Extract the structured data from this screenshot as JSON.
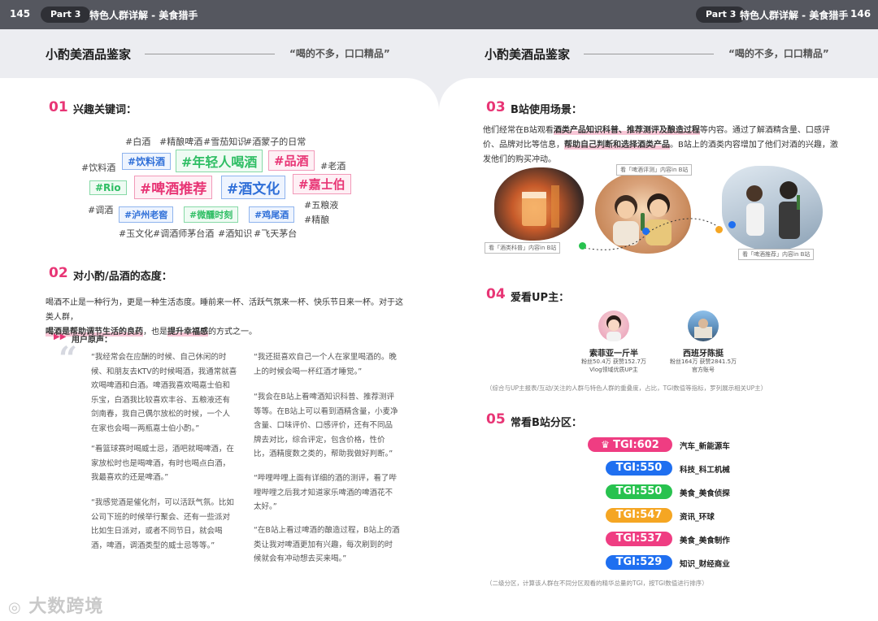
{
  "header": {
    "left_page_num": "145",
    "right_page_num": "146",
    "part_label": "Part 3",
    "section_title": "特色人群详解 - 美食猎手"
  },
  "section": {
    "title": "小酌美酒品鉴家",
    "tagline": "“喝的不多，口口精品”"
  },
  "left": {
    "s01": {
      "num": "01",
      "title": "兴趣关键词：",
      "tags": [
        "#白酒",
        "#精酿啤酒",
        "#雪茄知识",
        "#酒蒙子的日常",
        "#饮料酒",
        "#饮料酒",
        "#年轻人喝酒",
        "#品酒",
        "#老酒",
        "#Rio",
        "#啤酒推荐",
        "#酒文化",
        "#嘉士伯",
        "#五粮液",
        "#调酒",
        "#泸州老窖",
        "#微醺时刻",
        "#鸡尾酒",
        "#精酿",
        "#玉文化",
        "#调酒师茅台酒",
        "#酒知识",
        "#飞天茅台"
      ]
    },
    "s02": {
      "num": "02",
      "title": "对小酌/品酒的态度：",
      "p1": "喝酒不止是一种行为，更是一种生活态度。睡前来一杯、活跃气氛来一杯、快乐节日来一杯。对于这类人群，",
      "p2_hl1": "喝酒是帮助调节生活的良药",
      "p2_mid": "，也是",
      "p2_hl2": "提升幸福感",
      "p2_end": "的方式之一。",
      "voice_label": "用户原声：",
      "col1": [
        "“我经常会在应酬的时候、自己休闲的时候、和朋友去KTV的时候喝酒，我通常就喜欢喝啤酒和白酒。啤酒我喜欢喝嘉士伯和乐宝，白酒我比较喜欢丰谷、五粮液还有剑南春，我自己偶尔放松的时候，一个人在家也会喝一两瓶嘉士伯小酌。”",
        "“看篮球赛时喝威士忌，酒吧就喝啤酒，在家放松时也是喝啤酒，有时也喝点白酒，我最喜欢的还是啤酒。”",
        "“我感觉酒是催化剂，可以活跃气氛。比如公司下班的时候举行聚会、还有一些派对比如生日派对，或者不同节日，就会喝酒，啤酒，调酒类型的威士忌等等。”"
      ],
      "col2": [
        "“我还挺喜欢自己一个人在家里喝酒的。晚上的时候会喝一杯红酒才睡觉。”",
        "“我会在B站上看啤酒知识科普、推荐测评等等。在B站上可以看到酒精含量，小麦净含量、口味评价、口感评价，还有不同品牌去对比，综合评定，包含价格，性价比，酒精度数之类的，帮助我做好判断。”",
        "“哔哩哔哩上面有详细的酒的测评，看了哔哩哔哩之后我才知道家乐啤酒的啤酒花不太好。”",
        "“在B站上看过啤酒的酿造过程，B站上的酒类让我对啤酒更加有兴趣，每次刷到的时候就会有冲动想去买来喝。”"
      ]
    }
  },
  "right": {
    "s03": {
      "num": "03",
      "title": "B站使用场景：",
      "t1": "他们经常在B站观看",
      "hl1": "酒类产品知识科普、推荐测评及酿造过程",
      "t2": "等内容。通过了解酒精含量、口感评价、品牌对比等信息，",
      "hl2": "帮助自己判断和选择酒类产品",
      "t3": "。B站上的酒类内容增加了他们对酒的兴趣，激发他们的购买冲动。",
      "captions": [
        "看「酒类科普」内容in B站",
        "看「啤酒评测」内容in B站",
        "看「啤酒推荐」内容in B站"
      ]
    },
    "s04": {
      "num": "04",
      "title": "爱看UP主：",
      "ups": [
        {
          "name": "索菲亚一斤半",
          "meta1": "粉丝50.4万 获赞152.7万",
          "meta2": "Vlog领域优质UP主"
        },
        {
          "name": "西班牙陈挺",
          "meta1": "粉丝164万 获赞2841.5万",
          "meta2": "官方账号"
        }
      ],
      "note": "（综合与UP主报表/互动/关注的人群与特色人群的重叠度，占比，TGI数值等指标，罗列展示相关UP主）"
    },
    "s05": {
      "num": "05",
      "title": "常看B站分区：",
      "rows": [
        {
          "tgi": "TGI:602",
          "cat": "汽车_新能源车",
          "color": "#ef3d82"
        },
        {
          "tgi": "TGI:550",
          "cat": "科技_科工机械",
          "color": "#1f6ff0"
        },
        {
          "tgi": "TGI:550",
          "cat": "美食_美食侦探",
          "color": "#28c24f"
        },
        {
          "tgi": "TGI:547",
          "cat": "资讯_环球",
          "color": "#f5a623"
        },
        {
          "tgi": "TGI:537",
          "cat": "美食_美食制作",
          "color": "#ef3d82"
        },
        {
          "tgi": "TGI:529",
          "cat": "知识_财经商业",
          "color": "#1f6ff0"
        }
      ],
      "note": "（二级分区，计算该人群在不同分区观看的精华总量的TGI，按TGI数值进行排序）"
    }
  },
  "watermark": "大数跨境",
  "colors": {
    "accent": "#e83575",
    "header_bg": "#55575f"
  }
}
